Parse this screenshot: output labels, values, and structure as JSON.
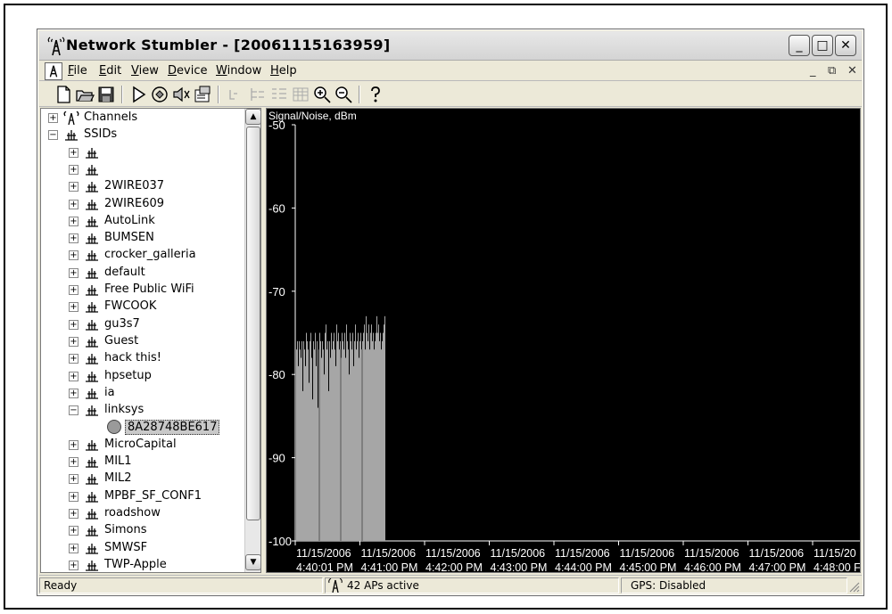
{
  "window": {
    "title": "Network Stumbler - [20061115163959]",
    "controls": {
      "minimize": "_",
      "maximize": "□",
      "close": "✕"
    }
  },
  "menubar": {
    "items": [
      {
        "label": "File",
        "key": "F",
        "rest": "ile"
      },
      {
        "label": "Edit",
        "key": "E",
        "rest": "dit"
      },
      {
        "label": "View",
        "key": "V",
        "rest": "iew"
      },
      {
        "label": "Device",
        "key": "D",
        "rest": "evice"
      },
      {
        "label": "Window",
        "key": "W",
        "rest": "indow"
      },
      {
        "label": "Help",
        "key": "H",
        "rest": "elp"
      }
    ],
    "mdi_controls": {
      "minimize": "_",
      "restore": "⧉",
      "close": "✕"
    }
  },
  "toolbar": {
    "buttons": [
      "new-file-icon",
      "open-folder-icon",
      "save-icon",
      "play-icon",
      "scan-icon",
      "mute-icon",
      "properties-icon",
      "filter-icon",
      "tree-icon",
      "list-icon",
      "grid-icon",
      "zoom-in-icon",
      "zoom-out-icon",
      "help-icon"
    ]
  },
  "tree": {
    "channels_label": "Channels",
    "ssids_label": "SSIDs",
    "ssids": [
      "",
      "",
      "2WIRE037",
      "2WIRE609",
      "AutoLink",
      "BUMSEN",
      "crocker_galleria",
      "default",
      "Free Public WiFi",
      "FWCOOK",
      "gu3s7",
      "Guest",
      "hack this!",
      "hpsetup",
      "ia",
      "linksys"
    ],
    "linksys_child": "8A28748BE617",
    "ssids_after": [
      "MicroCapital",
      "MIL1",
      "MIL2",
      "MPBF_SF_CONF1",
      "roadshow",
      "Simons",
      "SMWSF",
      "TWP-Apple"
    ]
  },
  "chart_data": {
    "type": "bar",
    "title": "Signal/Noise, dBm",
    "ylim": [
      -100,
      -50
    ],
    "y_ticks": [
      "-50",
      "-60",
      "-70",
      "-80",
      "-90",
      "-100"
    ],
    "x_tick_dates": [
      "11/15/2006",
      "11/15/2006",
      "11/15/2006",
      "11/15/2006",
      "11/15/2006",
      "11/15/2006",
      "11/15/2006",
      "11/15/2006",
      "11/15/20"
    ],
    "x_tick_times": [
      "4:40:01 PM",
      "4:41:00 PM",
      "4:42:00 PM",
      "4:43:00 PM",
      "4:44:00 PM",
      "4:45:00 PM",
      "4:46:00 PM",
      "4:47:00 PM",
      "4:48:00 F"
    ],
    "signal_values": [
      -77,
      -76,
      -79,
      -76,
      -77,
      -78,
      -76,
      -82,
      -76,
      -77,
      -79,
      -75,
      -76,
      -77,
      -81,
      -76,
      -75,
      -78,
      -83,
      -76,
      -77,
      -75,
      -79,
      -76,
      -84,
      -77,
      -75,
      -76,
      -78,
      -76,
      -77,
      -80,
      -75,
      -74,
      -77,
      -76,
      -82,
      -76,
      -78,
      -75,
      -77,
      -76,
      -75,
      -77,
      -79,
      -74,
      -76,
      -75,
      -77,
      -76,
      -78,
      -75,
      -76,
      -77,
      -75,
      -78,
      -74,
      -76,
      -77,
      -80,
      -75,
      -76,
      -77,
      -75,
      -79,
      -76,
      -74,
      -77,
      -76,
      -75,
      -78,
      -76,
      -75,
      -77,
      -76,
      -75,
      -74,
      -77,
      -73,
      -75,
      -76,
      -74,
      -77,
      -75,
      -74,
      -76,
      -75,
      -77,
      -76,
      -75,
      -73,
      -75,
      -74,
      -76,
      -75,
      -77,
      -76,
      -75,
      -74,
      -73
    ],
    "noise_floor": -100
  },
  "status": {
    "left": "Ready",
    "middle": "42 APs active",
    "right": "GPS: Disabled"
  },
  "colors": {
    "graph_bg": "#000000",
    "bar_fill": "#a6a6a6",
    "axis": "#ffffff"
  }
}
